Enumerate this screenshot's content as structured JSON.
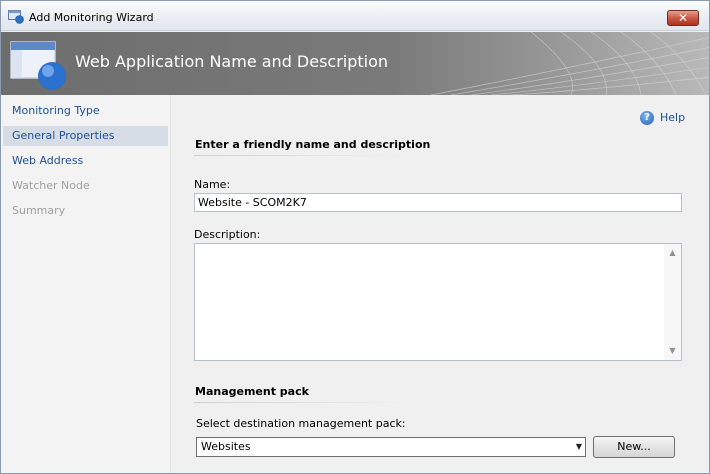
{
  "window": {
    "title": "Add Monitoring Wizard",
    "close_glyph": "✕"
  },
  "banner": {
    "title": "Web Application Name and Description"
  },
  "nav": {
    "items": [
      {
        "label": "Monitoring Type",
        "state": "normal"
      },
      {
        "label": "General Properties",
        "state": "selected"
      },
      {
        "label": "Web Address",
        "state": "normal"
      },
      {
        "label": "Watcher Node",
        "state": "disabled"
      },
      {
        "label": "Summary",
        "state": "disabled"
      }
    ]
  },
  "help": {
    "label": "Help",
    "icon": "help-icon"
  },
  "general": {
    "section_title": "Enter a friendly name and description",
    "name_label": "Name:",
    "name_value": "Website - SCOM2K7",
    "description_label": "Description:",
    "description_value": ""
  },
  "management_pack": {
    "section_title": "Management pack",
    "select_label": "Select destination management pack:",
    "selected_value": "Websites",
    "new_button": "New..."
  },
  "colors": {
    "link": "#1f4f94",
    "selected_nav_bg": "#d6dde6",
    "disabled_text": "#a0a0a0",
    "banner_bg": "#7a7a7a"
  }
}
